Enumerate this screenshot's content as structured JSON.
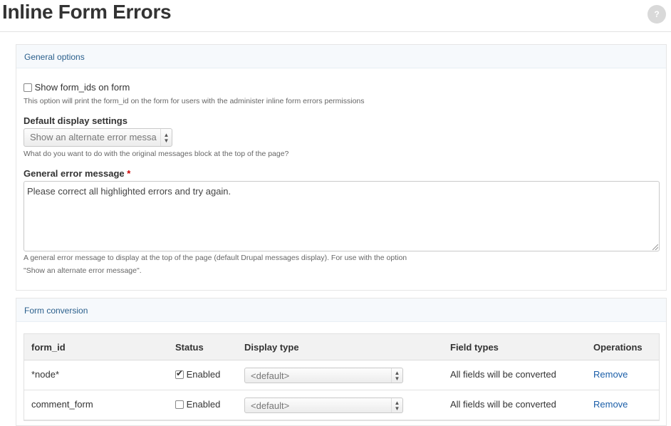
{
  "header": {
    "title": "Inline Form Errors",
    "help_icon": "?"
  },
  "general": {
    "legend": "General options",
    "show_form_ids": {
      "label": "Show form_ids on form",
      "checked": false,
      "description": "This option will print the form_id on the form for users with the administer inline form errors permissions"
    },
    "display_settings": {
      "label": "Default display settings",
      "value": "Show an alternate error messa",
      "description": "What do you want to do with the original messages block at the top of the page?"
    },
    "error_message": {
      "label": "General error message",
      "required_marker": "*",
      "value": "Please correct all highlighted errors and try again.",
      "description_line1": "A general error message to display at the top of the page (default Drupal messages display). For use with the option",
      "description_line2": "\"Show an alternate error message\"."
    }
  },
  "conversion": {
    "legend": "Form conversion",
    "columns": [
      "form_id",
      "Status",
      "Display type",
      "Field types",
      "Operations"
    ],
    "rows": [
      {
        "form_id": "*node*",
        "status_checked": true,
        "status": "Enabled",
        "display_type": "<default>",
        "field_types": "All fields will be converted",
        "operation": "Remove"
      },
      {
        "form_id": "comment_form",
        "status_checked": false,
        "status": "Enabled",
        "display_type": "<default>",
        "field_types": "All fields will be converted",
        "operation": "Remove"
      }
    ]
  }
}
